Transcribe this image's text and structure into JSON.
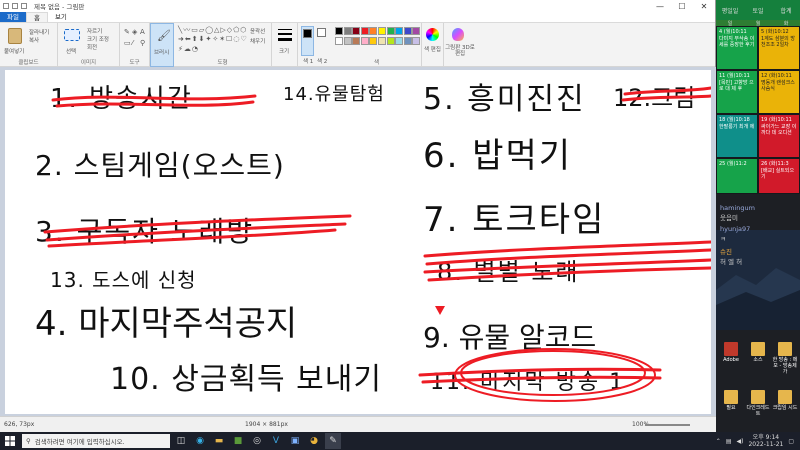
{
  "window": {
    "title": "제목 없음 - 그림판"
  },
  "tabs": [
    "파일",
    "홈",
    "보기"
  ],
  "ribbon": {
    "clipboard": {
      "label": "클립보드",
      "paste": "붙여넣기",
      "cut": "잘라내기",
      "copy": "복사"
    },
    "image": {
      "label": "이미지",
      "select": "선택",
      "crop": "자르기",
      "resize": "크기 조정",
      "rotate": "회전"
    },
    "tools": {
      "label": "도구"
    },
    "brush": {
      "label": "브러시"
    },
    "shapes": {
      "label": "도형",
      "outline": "윤곽선",
      "fill": "채우기"
    },
    "size": {
      "label": "크기"
    },
    "color1": {
      "label": "색 1"
    },
    "color2": {
      "label": "색 2"
    },
    "colors": {
      "label": "색"
    },
    "edit_colors": "색 편집",
    "paint3d": "그림판 3D로 편집"
  },
  "palette": [
    "#000000",
    "#7f7f7f",
    "#880015",
    "#ed1c24",
    "#ff7f27",
    "#fff200",
    "#22b14c",
    "#00a2e8",
    "#3f48cc",
    "#a349a4",
    "#ffffff",
    "#c3c3c3",
    "#b97a57",
    "#ffaec9",
    "#ffc90e",
    "#efe4b0",
    "#b5e61d",
    "#99d9ea",
    "#7092be",
    "#c8bfe7"
  ],
  "canvas_text": [
    "1. 방송시간",
    "14.유물탐험",
    "5. 흥미진진",
    "12.그림",
    "2. 스팀게임(오스트)",
    "6. 밥먹기",
    "3. 구독자 노래방",
    "7. 토크타임",
    "13. 도스에 신청",
    "8. 별별 노래",
    "4. 마지막주석공지",
    "9. 유물 알코드",
    "10. 상금획득 보내기",
    "11. 마지막 방송 1"
  ],
  "status": {
    "cursor": "626, 73px",
    "size": "1904 × 881px",
    "zoom": "100%"
  },
  "calendar": {
    "head": [
      "평일일",
      "토일",
      "합계"
    ],
    "sub": [
      "일",
      "월",
      "화"
    ],
    "rows": [
      [
        {
          "d": "4 (월)10:11",
          "t": "다미지 부삭송 이세를 중장한 후기"
        },
        {
          "d": "5 (화)10:12",
          "t": "1계도 삼분의 방 천조조 2일차"
        }
      ],
      [
        {
          "d": "11 (월)10:11",
          "t": "[목민] 고향방 으로 대 제 후"
        },
        {
          "d": "12 (화)10:11",
          "t": "명동개 랜섬크스 사슴식"
        }
      ],
      [
        {
          "d": "18 (월)10:18",
          "t": "한팔롱기 최개 에"
        },
        {
          "d": "19 (화)10:11",
          "t": "싸이가느 교장 이 까다 데 오디션"
        }
      ],
      [
        {
          "d": "25 (월)11:2",
          "t": ""
        },
        {
          "d": "26 (화)11:3",
          "t": "[배교] 실트되으기"
        }
      ]
    ]
  },
  "chat": [
    {
      "user": "hamingum",
      "msg": "웃음미"
    },
    {
      "user": "hyunja97",
      "msg": "ㅋ"
    },
    {
      "user": "슈진",
      "msg": "허 엘 허"
    }
  ],
  "desktop": [
    {
      "label": "Adobe"
    },
    {
      "label": "소스"
    },
    {
      "label": "한 방송 : 메모 - 방송제가"
    },
    {
      "label": "필요"
    },
    {
      "label": "다인크레드트"
    },
    {
      "label": "크립임 시드"
    }
  ],
  "taskbar": {
    "search_placeholder": "검색하려면 여기에 입력하십시오.",
    "time": "오후 9:14",
    "date": "2022-11-21"
  }
}
